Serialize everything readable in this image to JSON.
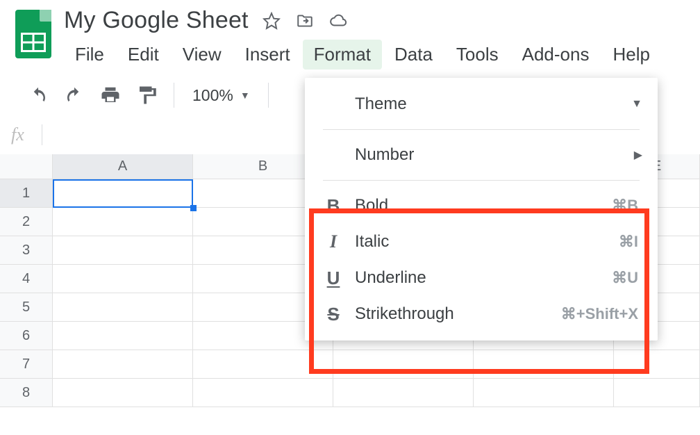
{
  "header": {
    "title": "My Google Sheet"
  },
  "menubar": {
    "items": [
      {
        "label": "File"
      },
      {
        "label": "Edit"
      },
      {
        "label": "View"
      },
      {
        "label": "Insert"
      },
      {
        "label": "Format",
        "active": true
      },
      {
        "label": "Data"
      },
      {
        "label": "Tools"
      },
      {
        "label": "Add-ons"
      },
      {
        "label": "Help"
      }
    ]
  },
  "toolbar": {
    "zoom": "100%"
  },
  "fx": {
    "label": "fx"
  },
  "columns": [
    "A",
    "B",
    "E"
  ],
  "rows": [
    "1",
    "2",
    "3",
    "4",
    "5",
    "6",
    "7",
    "8"
  ],
  "dropdown": {
    "theme": {
      "label": "Theme"
    },
    "number": {
      "label": "Number"
    },
    "bold": {
      "label": "Bold",
      "shortcut": "⌘B"
    },
    "italic": {
      "label": "Italic",
      "shortcut": "⌘I"
    },
    "underline": {
      "label": "Underline",
      "shortcut": "⌘U"
    },
    "strike": {
      "label": "Strikethrough",
      "shortcut": "⌘+Shift+X"
    }
  }
}
